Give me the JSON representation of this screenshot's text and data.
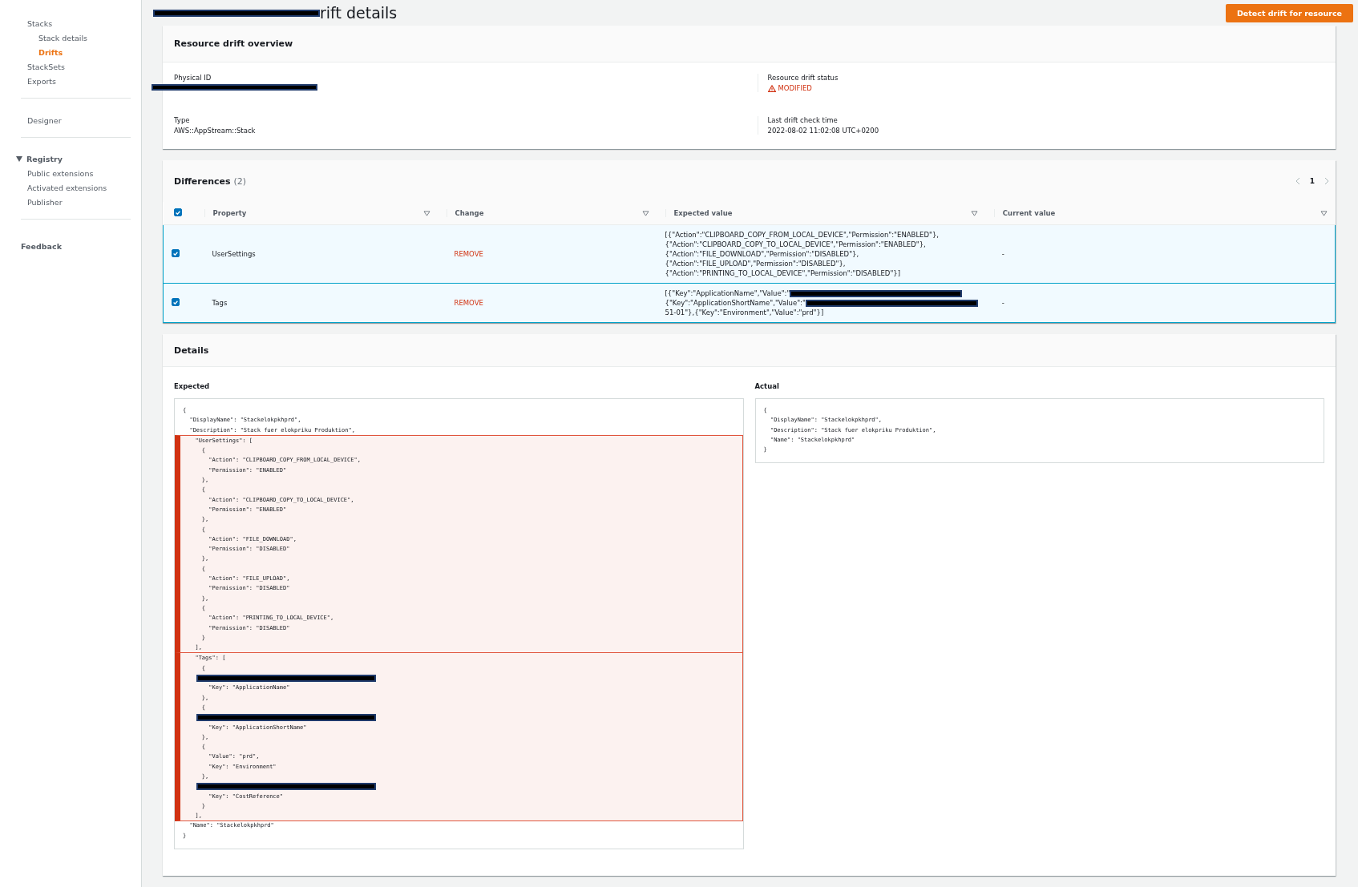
{
  "sidebar": {
    "sections": [
      {
        "kind": "links",
        "items": [
          {
            "label": "Stacks",
            "selected": false,
            "children": [
              {
                "label": "Stack details",
                "selected": false
              },
              {
                "label": "Drifts",
                "selected": true
              }
            ]
          },
          {
            "label": "StackSets",
            "selected": false
          },
          {
            "label": "Exports",
            "selected": false
          }
        ]
      },
      {
        "kind": "links",
        "items": [
          {
            "label": "Designer",
            "selected": false
          }
        ]
      },
      {
        "kind": "group",
        "heading": "Registry",
        "expanded": true,
        "items": [
          {
            "label": "Public extensions",
            "selected": false
          },
          {
            "label": "Activated extensions",
            "selected": false
          },
          {
            "label": "Publisher",
            "selected": false
          }
        ]
      },
      {
        "kind": "footer",
        "items": [
          {
            "label": "Feedback"
          }
        ]
      }
    ]
  },
  "header": {
    "title_redacted": true,
    "title": "rift details",
    "button": "Detect drift for resource"
  },
  "overview": {
    "title": "Resource drift overview",
    "fields": [
      {
        "kind": "redacted",
        "label": "Physical ID"
      },
      {
        "kind": "status",
        "label": "Resource drift status",
        "value": "MODIFIED"
      },
      {
        "kind": "text",
        "label": "Type",
        "value": "AWS::AppStream::Stack"
      },
      {
        "kind": "text",
        "label": "Last drift check time",
        "value": "2022-08-02 11:02:08 UTC+0200"
      }
    ]
  },
  "differences": {
    "title": "Differences",
    "count": "(2)",
    "page": "1",
    "all_selected": true,
    "columns": [
      "Property",
      "Change",
      "Expected value",
      "Current value"
    ],
    "rows": [
      {
        "selected": true,
        "property": "UserSettings",
        "change": "REMOVE",
        "current": "-",
        "expected": [
          {
            "text": "[{\"Action\":\"CLIPBOARD_COPY_FROM_LOCAL_DEVICE\",\"Permission\":\"ENABLED\"},",
            "redacted": false
          },
          {
            "text": "{\"Action\":\"CLIPBOARD_COPY_TO_LOCAL_DEVICE\",\"Permission\":\"ENABLED\"},",
            "redacted": false
          },
          {
            "text": "{\"Action\":\"FILE_DOWNLOAD\",\"Permission\":\"DISABLED\"},",
            "redacted": false
          },
          {
            "text": "{\"Action\":\"FILE_UPLOAD\",\"Permission\":\"DISABLED\"},",
            "redacted": false
          },
          {
            "text": "{\"Action\":\"PRINTING_TO_LOCAL_DEVICE\",\"Permission\":\"DISABLED\"}]",
            "redacted": false
          }
        ]
      },
      {
        "selected": true,
        "property": "Tags",
        "change": "REMOVE",
        "current": "-",
        "expected": [
          {
            "text": "[{\"Key\":\"ApplicationName\",\"Value\":\"",
            "redacted": true
          },
          {
            "text": "{\"Key\":\"ApplicationShortName\",\"Value\":\"",
            "redacted": true
          },
          {
            "text": "51-01\"},{\"Key\":\"Environment\",\"Value\":\"prd\"}]",
            "redacted": false
          }
        ]
      }
    ]
  },
  "details": {
    "title": "Details",
    "expected": {
      "label": "Expected",
      "blocks": [
        {
          "kind": "plain",
          "lines": [
            {
              "kind": "code",
              "text": "{"
            },
            {
              "kind": "code",
              "text": "  \"DisplayName\": \"Stackelokpkhprd\","
            },
            {
              "kind": "code",
              "text": "  \"Description\": \"Stack fuer elokpriku Produktion\","
            }
          ]
        },
        {
          "kind": "removed",
          "lines": [
            {
              "kind": "code",
              "text": "  \"UserSettings\": ["
            },
            {
              "kind": "code",
              "text": "    {"
            },
            {
              "kind": "code",
              "text": "      \"Action\": \"CLIPBOARD_COPY_FROM_LOCAL_DEVICE\","
            },
            {
              "kind": "code",
              "text": "      \"Permission\": \"ENABLED\""
            },
            {
              "kind": "code",
              "text": "    },"
            },
            {
              "kind": "code",
              "text": "    {"
            },
            {
              "kind": "code",
              "text": "      \"Action\": \"CLIPBOARD_COPY_TO_LOCAL_DEVICE\","
            },
            {
              "kind": "code",
              "text": "      \"Permission\": \"ENABLED\""
            },
            {
              "kind": "code",
              "text": "    },"
            },
            {
              "kind": "code",
              "text": "    {"
            },
            {
              "kind": "code",
              "text": "      \"Action\": \"FILE_DOWNLOAD\","
            },
            {
              "kind": "code",
              "text": "      \"Permission\": \"DISABLED\""
            },
            {
              "kind": "code",
              "text": "    },"
            },
            {
              "kind": "code",
              "text": "    {"
            },
            {
              "kind": "code",
              "text": "      \"Action\": \"FILE_UPLOAD\","
            },
            {
              "kind": "code",
              "text": "      \"Permission\": \"DISABLED\""
            },
            {
              "kind": "code",
              "text": "    },"
            },
            {
              "kind": "code",
              "text": "    {"
            },
            {
              "kind": "code",
              "text": "      \"Action\": \"PRINTING_TO_LOCAL_DEVICE\","
            },
            {
              "kind": "code",
              "text": "      \"Permission\": \"DISABLED\""
            },
            {
              "kind": "code",
              "text": "    }"
            },
            {
              "kind": "code",
              "text": "  ],"
            }
          ]
        },
        {
          "kind": "removed",
          "lines": [
            {
              "kind": "code",
              "text": "  \"Tags\": ["
            },
            {
              "kind": "code",
              "text": "    {"
            },
            {
              "kind": "redacted"
            },
            {
              "kind": "code",
              "text": "      \"Key\": \"ApplicationName\""
            },
            {
              "kind": "code",
              "text": "    },"
            },
            {
              "kind": "code",
              "text": "    {"
            },
            {
              "kind": "redacted"
            },
            {
              "kind": "code",
              "text": "      \"Key\": \"ApplicationShortName\""
            },
            {
              "kind": "code",
              "text": "    },"
            },
            {
              "kind": "code",
              "text": "    {"
            },
            {
              "kind": "code",
              "text": "      \"Value\": \"prd\","
            },
            {
              "kind": "code",
              "text": "      \"Key\": \"Environment\""
            },
            {
              "kind": "code",
              "text": "    },"
            },
            {
              "kind": "redacted"
            },
            {
              "kind": "code",
              "text": "      \"Key\": \"CostReference\""
            },
            {
              "kind": "code",
              "text": "    }"
            },
            {
              "kind": "code",
              "text": "  ],"
            }
          ]
        },
        {
          "kind": "plain",
          "lines": [
            {
              "kind": "code",
              "text": "  \"Name\": \"Stackelokpkhprd\""
            },
            {
              "kind": "code",
              "text": "}"
            }
          ]
        }
      ]
    },
    "actual": {
      "label": "Actual",
      "blocks": [
        {
          "kind": "plain",
          "lines": [
            {
              "kind": "code",
              "text": "{"
            },
            {
              "kind": "code",
              "text": "  \"DisplayName\": \"Stackelokpkhprd\","
            },
            {
              "kind": "code",
              "text": "  \"Description\": \"Stack fuer elokpriku Produktion\","
            },
            {
              "kind": "code",
              "text": "  \"Name\": \"Stackelokpkhprd\""
            },
            {
              "kind": "code",
              "text": "}"
            }
          ]
        }
      ]
    }
  }
}
